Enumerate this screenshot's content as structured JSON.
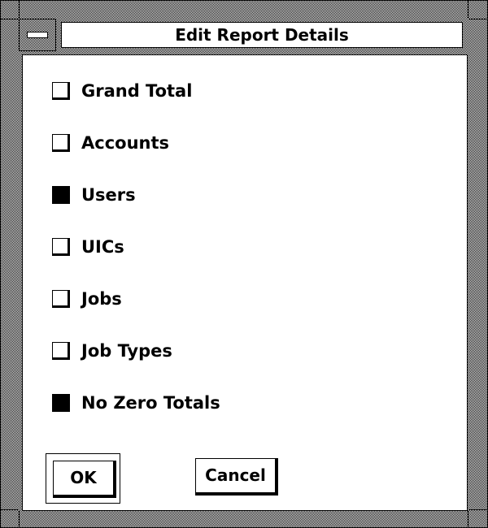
{
  "window": {
    "title": "Edit Report Details"
  },
  "options": [
    {
      "label": "Grand Total",
      "checked": false
    },
    {
      "label": "Accounts",
      "checked": false
    },
    {
      "label": "Users",
      "checked": true
    },
    {
      "label": "UICs",
      "checked": false
    },
    {
      "label": "Jobs",
      "checked": false
    },
    {
      "label": "Job Types",
      "checked": false
    },
    {
      "label": "No Zero Totals",
      "checked": true
    }
  ],
  "buttons": {
    "ok_label": "OK",
    "cancel_label": "Cancel"
  }
}
